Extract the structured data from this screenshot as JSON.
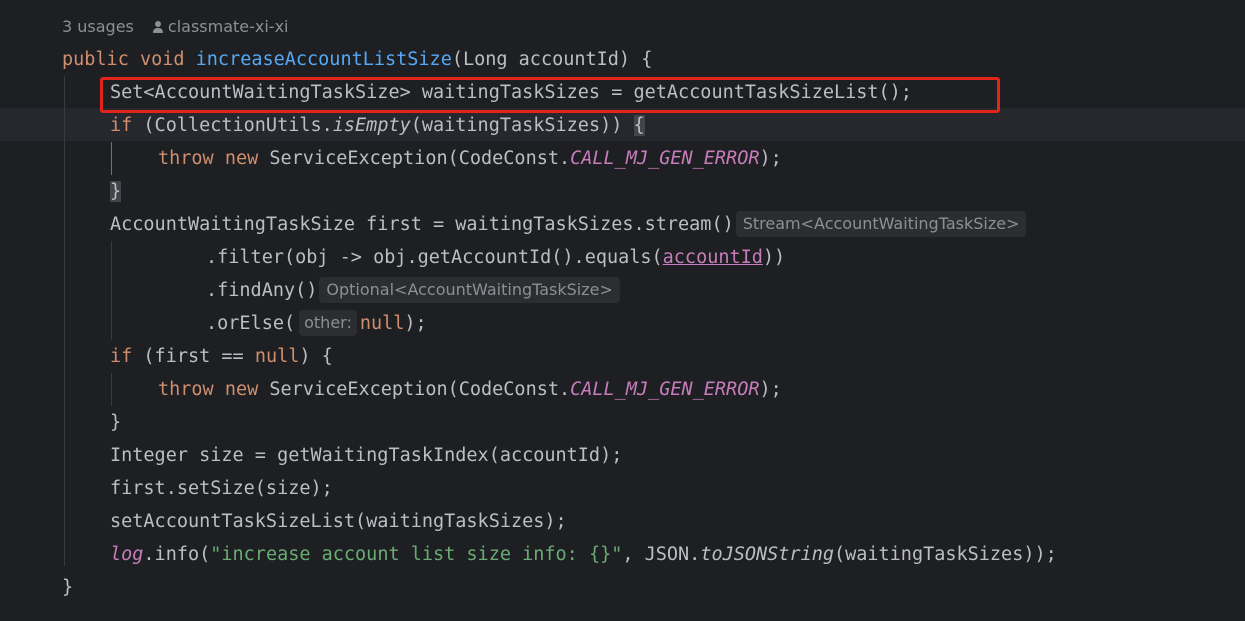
{
  "meta": {
    "usages": "3 usages",
    "author": "classmate-xi-xi"
  },
  "code": {
    "l1": {
      "kw": "public void ",
      "fn": "increaseAccountListSize",
      "rest": "(Long accountId) {"
    },
    "l2": {
      "text": "Set<AccountWaitingTaskSize> waitingTaskSizes = getAccountTaskSizeList();"
    },
    "l3": {
      "kw": "if",
      "a": " (CollectionUtils.",
      "it": "isEmpty",
      "b": "(waitingTaskSizes)) ",
      "brace": "{"
    },
    "l4": {
      "kw": "throw new ",
      "a": "ServiceException(CodeConst.",
      "cst": "CALL_MJ_GEN_ERROR",
      "b": ");"
    },
    "l5": {
      "brace": "}"
    },
    "l6": {
      "text": "AccountWaitingTaskSize first = waitingTaskSizes.stream()",
      "hint": "Stream<AccountWaitingTaskSize>"
    },
    "l7": {
      "a": ".filter(obj -> obj.getAccountId().equals(",
      "prm": "accountId",
      "b": "))"
    },
    "l8": {
      "text": ".findAny()",
      "hint": "Optional<AccountWaitingTaskSize>"
    },
    "l9": {
      "a": ".orElse(",
      "hint": "other:",
      "kw": "null",
      "b": ");"
    },
    "l10": {
      "kw": "if",
      "a": " (first == ",
      "kw2": "null",
      "b": ") {"
    },
    "l11": {
      "kw": "throw new ",
      "a": "ServiceException(CodeConst.",
      "cst": "CALL_MJ_GEN_ERROR",
      "b": ");"
    },
    "l12": {
      "text": "}"
    },
    "l13": {
      "text": "Integer size = getWaitingTaskIndex(accountId);"
    },
    "l14": {
      "text": "first.setSize(size);"
    },
    "l15": {
      "text": "setAccountTaskSizeList(waitingTaskSizes);"
    },
    "l16": {
      "cst": "log",
      "a": ".info(",
      "str": "\"increase account list size info: {}\"",
      "b": ", JSON.",
      "it": "toJSONString",
      "c": "(waitingTaskSizes));"
    },
    "l17": {
      "text": "}"
    }
  },
  "colors": {
    "background": "#1e1f22",
    "keyword": "#cf8e6d",
    "function": "#56a8f5",
    "constant": "#c77dbb",
    "string": "#6aab73",
    "highlight_box": "#e3241b"
  }
}
